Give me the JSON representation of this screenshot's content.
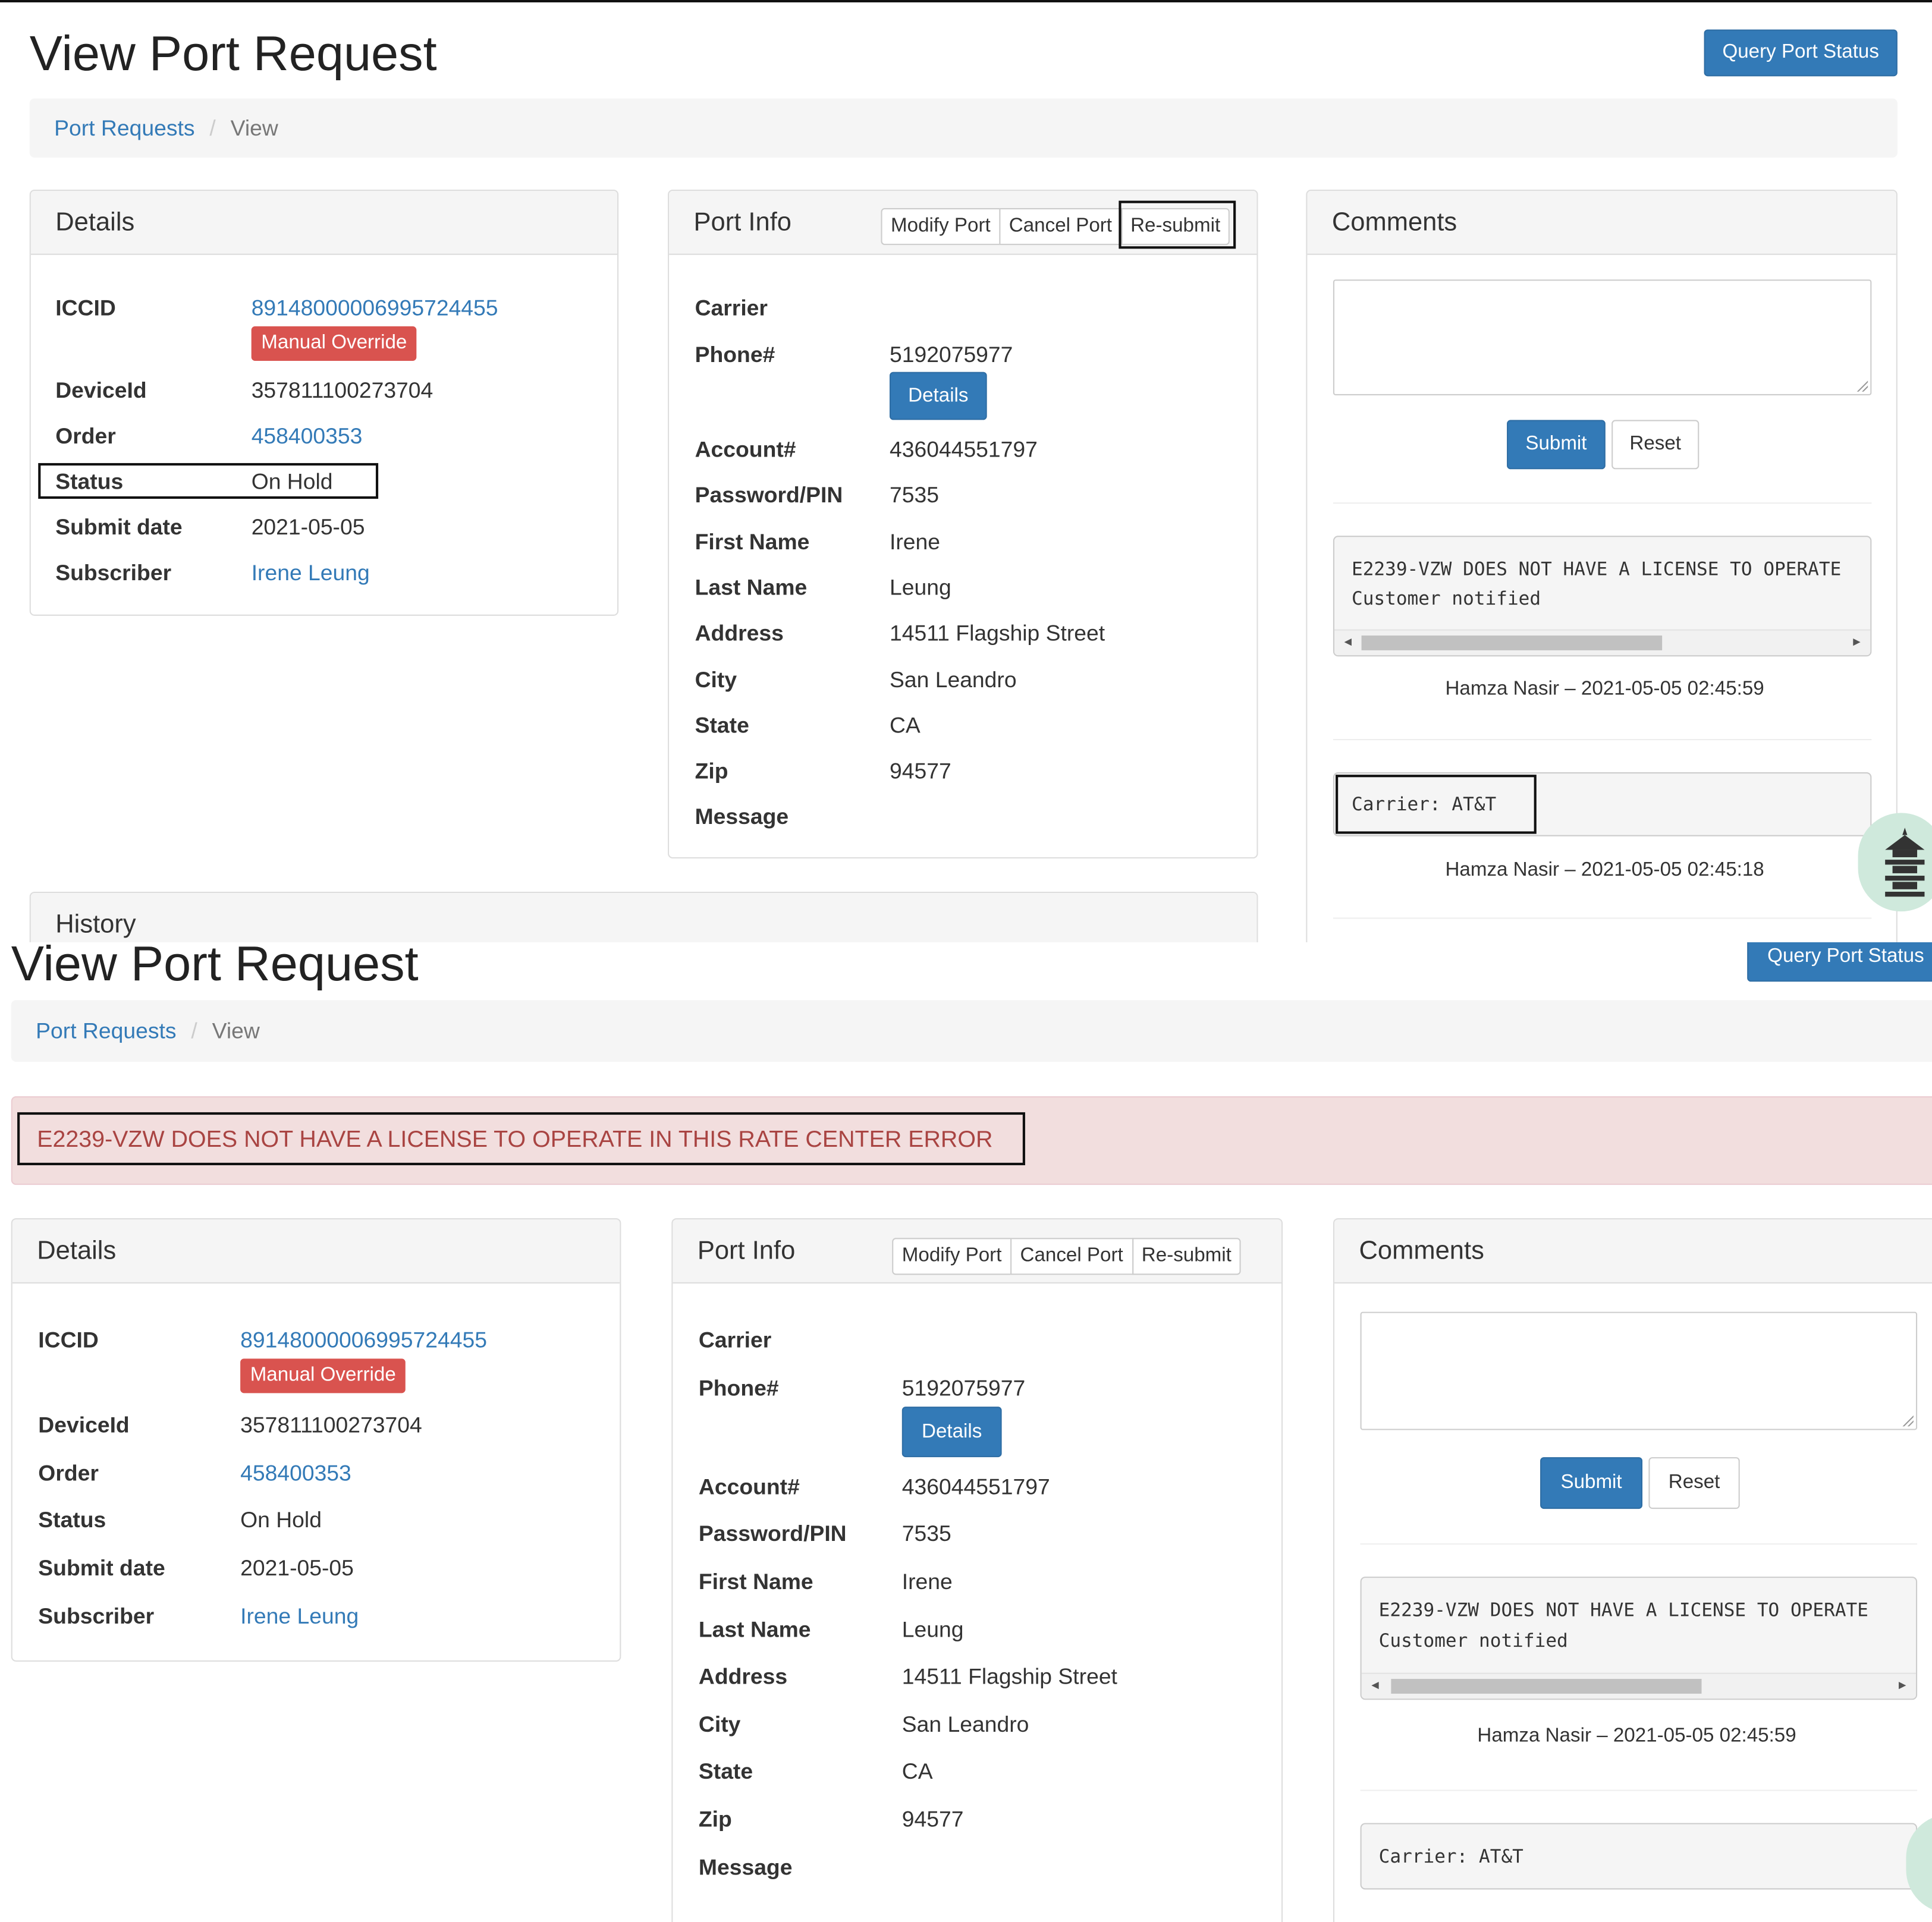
{
  "page": {
    "title": "View Port Request",
    "query_button": "Query Port Status",
    "breadcrumb": {
      "link": "Port Requests",
      "separator": "/",
      "current": "View"
    }
  },
  "alert": {
    "message": "E2239-VZW DOES NOT HAVE A LICENSE TO OPERATE IN THIS RATE CENTER ERROR"
  },
  "details": {
    "heading": "Details",
    "iccid_label": "ICCID",
    "iccid": "89148000006995724455",
    "badge": "Manual Override",
    "device_label": "DeviceId",
    "device": "357811100273704",
    "order_label": "Order",
    "order": "458400353",
    "status_label": "Status",
    "status": "On Hold",
    "submit_label": "Submit date",
    "submit": "2021-05-05",
    "subscriber_label": "Subscriber",
    "subscriber": "Irene Leung"
  },
  "port_info": {
    "heading": "Port Info",
    "modify": "Modify Port",
    "cancel": "Cancel Port",
    "resubmit": "Re-submit",
    "carrier_label": "Carrier",
    "phone_label": "Phone#",
    "phone": "5192075977",
    "details_button": "Details",
    "account_label": "Account#",
    "account": "436044551797",
    "pin_label": "Password/PIN",
    "pin": "7535",
    "first_label": "First Name",
    "first": "Irene",
    "last_label": "Last Name",
    "last": "Leung",
    "address_label": "Address",
    "address": "14511 Flagship Street",
    "city_label": "City",
    "city": "San Leandro",
    "state_label": "State",
    "state": "CA",
    "zip_label": "Zip",
    "zip": "94577",
    "message_label": "Message"
  },
  "comments": {
    "heading": "Comments",
    "submit": "Submit",
    "reset": "Reset",
    "c1_line1": "E2239-VZW DOES NOT HAVE A LICENSE TO OPERATE",
    "c1_line2": "Customer notified",
    "c1_meta": "Hamza Nasir – 2021-05-05 02:45:59",
    "c2_line1": "Carrier: AT&T",
    "c2_meta": "Hamza Nasir – 2021-05-05 02:45:18"
  },
  "history": {
    "heading": "History"
  },
  "colors": {
    "primary": "#337ab7",
    "danger": "#d9534f",
    "alert_bg": "#f2dede",
    "alert_text": "#a94442"
  },
  "icons": {
    "fab": "tower-icon"
  }
}
